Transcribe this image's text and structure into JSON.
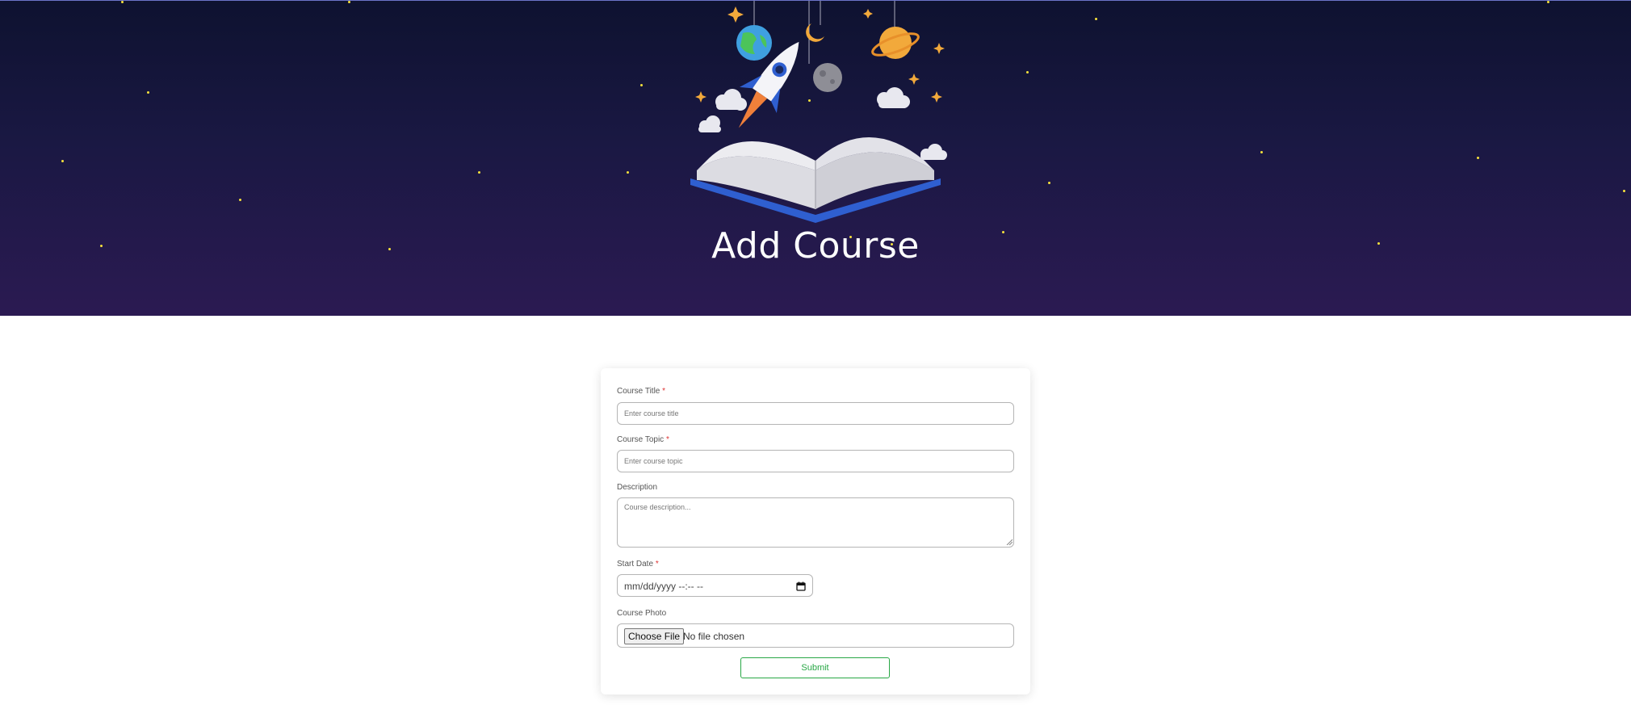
{
  "header": {
    "title": "Add Course",
    "illustration": "rocket-book-space-illustration"
  },
  "colors": {
    "hero_top": "#0e1230",
    "hero_bottom": "#2b1a52",
    "star": "#f7e23c",
    "submit": "#28a745",
    "required": "#dd3333"
  },
  "form": {
    "title_label": "Course Title",
    "title_placeholder": "Enter course title",
    "topic_label": "Course Topic",
    "topic_placeholder": "Enter course topic",
    "description_label": "Description",
    "description_placeholder": "Course description...",
    "start_date_label": "Start Date",
    "start_date_value": "mm/dd/yyyy --:-- --",
    "photo_label": "Course Photo",
    "choose_file_label": "Choose File",
    "file_status": "No file chosen",
    "required_marker": "*",
    "submit_label": "Submit"
  }
}
